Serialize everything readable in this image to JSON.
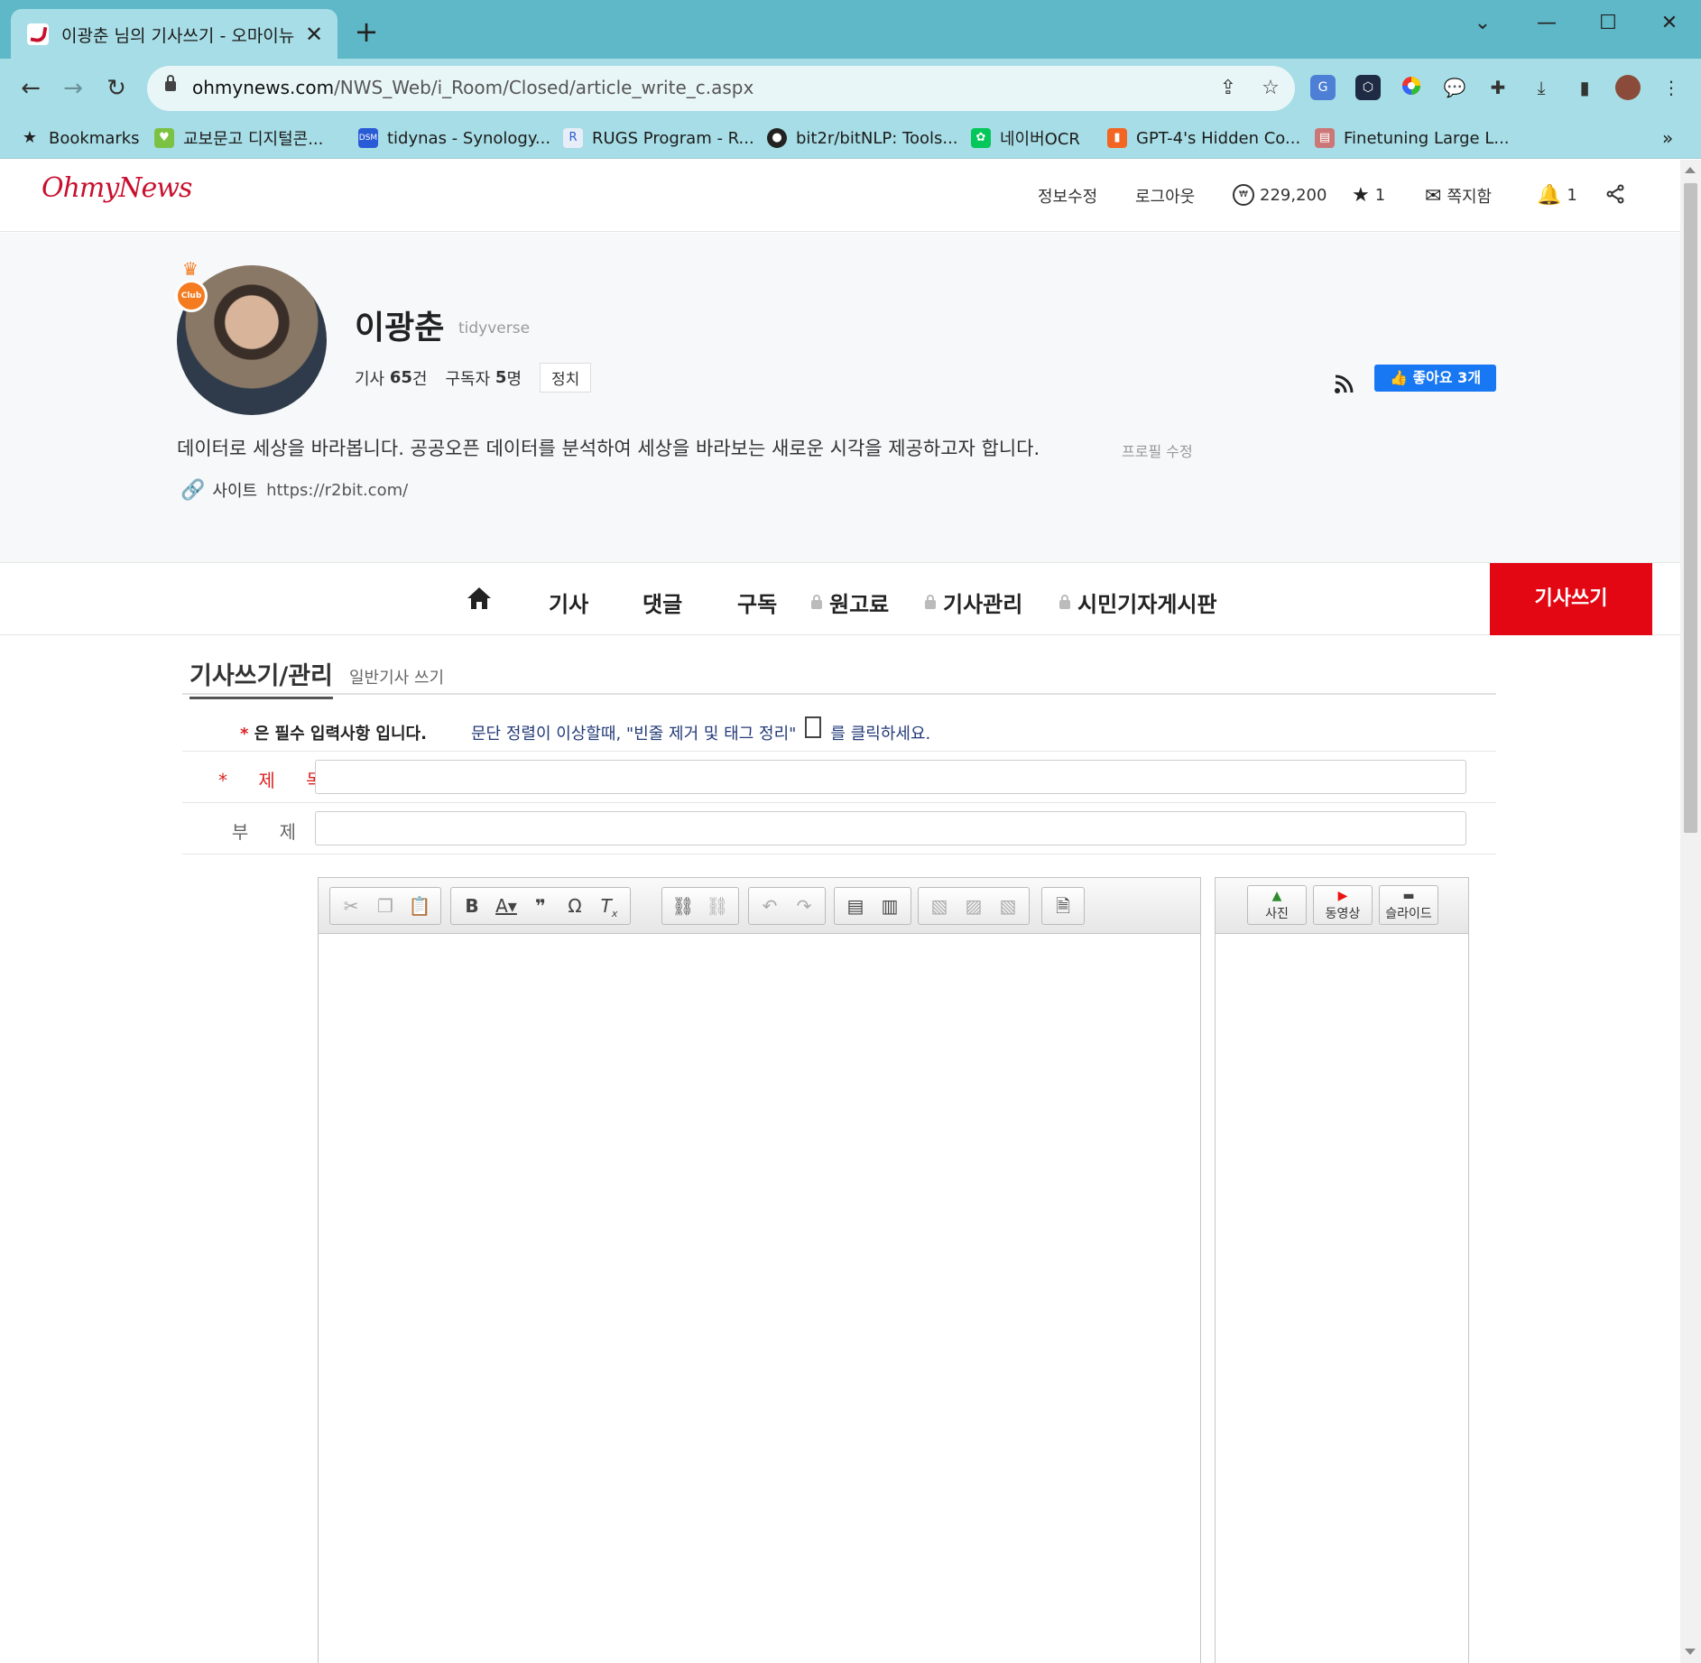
{
  "browser": {
    "tab_title": "이광춘 님의 기사쓰기 - 오마이뉴",
    "url_domain": "ohmynews.com",
    "url_path": "/NWS_Web/i_Room/Closed/article_write_c.aspx",
    "bookmarks": [
      {
        "label": "Bookmarks",
        "icon": "star-icon"
      },
      {
        "label": "교보문고 디지털콘...",
        "icon": "kyobo-icon"
      },
      {
        "label": "tidynas - Synology...",
        "icon": "dsm-icon"
      },
      {
        "label": "RUGS Program - R...",
        "icon": "r-icon"
      },
      {
        "label": "bit2r/bitNLP: Tools...",
        "icon": "github-icon"
      },
      {
        "label": "네이버OCR",
        "icon": "naver-ocr-icon"
      },
      {
        "label": "GPT-4's Hidden Co...",
        "icon": "bookmark-ribbon-icon"
      },
      {
        "label": "Finetuning Large L...",
        "icon": "page-icon"
      }
    ],
    "colors": {
      "tabbar": "#5eb8c7",
      "toolbar": "#a7dde6"
    }
  },
  "site": {
    "logo": "OhmyNews",
    "nav": {
      "edit_info": "정보수정",
      "logout": "로그아웃",
      "points": "229,200",
      "stars": "1",
      "mailbox": "쪽지함",
      "notifications": "1"
    },
    "brand_color": "#c8102e"
  },
  "profile": {
    "name": "이광춘",
    "user_id": "tidyverse",
    "articles_label": "기사",
    "articles_count": "65",
    "articles_unit": "건",
    "subscribers_label": "구독자",
    "subscribers_count": "5",
    "subscribers_unit": "명",
    "category": "정치",
    "like_button": "좋아요 3개",
    "intro": "데이터로 세상을 바라봅니다. 공공오픈 데이터를 분석하여 세상을 바라보는 새로운 시각을 제공하고자 합니다.",
    "intro_edit": "프로필 수정",
    "site_label": "사이트",
    "site_url": "https://r2bit.com/",
    "club_badge": "Club"
  },
  "subnav": {
    "items": [
      "기사",
      "댓글",
      "구독"
    ],
    "locked_items": [
      "원고료",
      "기사관리",
      "시민기자게시판"
    ],
    "write_button": "기사쓰기"
  },
  "form": {
    "section_title": "기사쓰기/관리",
    "section_subtitle": "일반기사 쓰기",
    "required_mark": "*",
    "required_note": "은 필수 입력사항 입니다.",
    "tip_before": "문단 정렬이 이상할때, \"빈줄 제거 및 태그 정리\"",
    "tip_after": "를 클릭하세요.",
    "title_label": "제 목",
    "subtitle_label": "부 제",
    "title_value": "",
    "subtitle_value": "",
    "editor_tools": [
      "cut-icon",
      "copy-icon",
      "paste-icon",
      "bold-icon",
      "text-color-icon",
      "blockquote-icon",
      "special-char-icon",
      "remove-format-icon",
      "link-icon",
      "unlink-icon",
      "undo-icon",
      "redo-icon",
      "table-icon",
      "page-break-icon",
      "image-left-icon",
      "image-center-icon",
      "image-right-icon",
      "clean-tags-icon"
    ],
    "media_buttons": {
      "photo": "사진",
      "video": "동영상",
      "slide": "슬라이드"
    }
  }
}
